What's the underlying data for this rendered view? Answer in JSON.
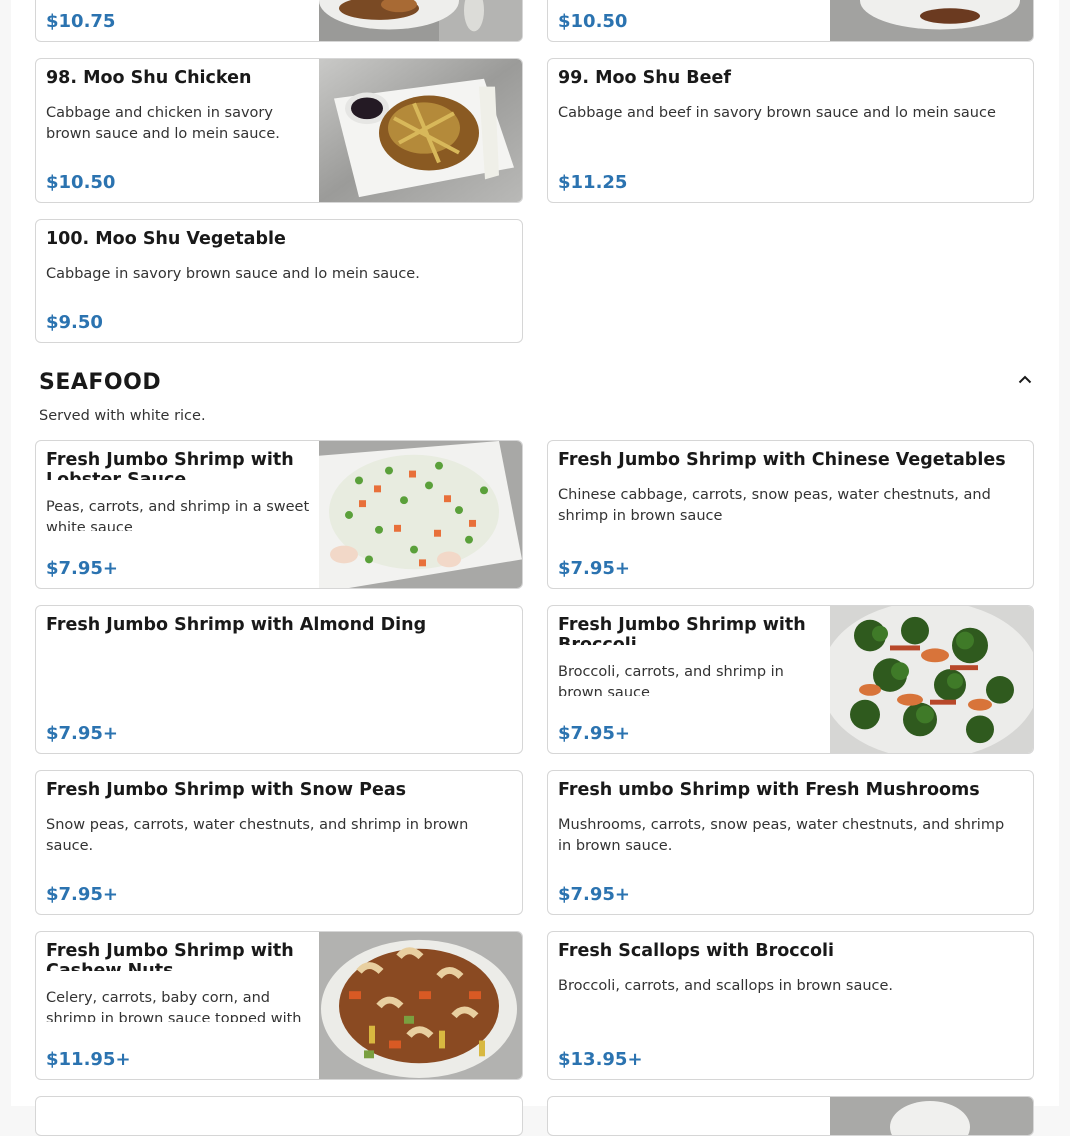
{
  "colors": {
    "price": "#2b73b0",
    "border": "#d6d6d6"
  },
  "top_cards": [
    {
      "price": "$10.75"
    },
    {
      "price": "$10.50"
    }
  ],
  "items": [
    {
      "title": "98. Moo Shu Chicken",
      "description": "Cabbage and chicken in savory brown sauce and lo mein sauce.",
      "price": "$10.50",
      "image": "moo-shu-chicken-photo"
    },
    {
      "title": "99. Moo Shu Beef",
      "description": "Cabbage and beef in savory brown sauce and lo mein sauce",
      "price": "$11.25"
    },
    {
      "title": "100. Moo Shu Vegetable",
      "description": "Cabbage in savory brown sauce and lo mein sauce.",
      "price": "$9.50"
    }
  ],
  "seafood": {
    "title": "SEAFOOD",
    "subtitle": "Served with white rice.",
    "collapse_icon": "chevron-up-icon",
    "items": [
      {
        "title": "Fresh Jumbo Shrimp with Lobster Sauce",
        "description": "Peas, carrots, and shrimp in a sweet white sauce",
        "price": "$7.95+",
        "image": "shrimp-lobster-sauce-photo"
      },
      {
        "title": "Fresh Jumbo Shrimp with Chinese Vegetables",
        "description": "Chinese cabbage, carrots, snow peas, water chestnuts, and shrimp in brown sauce",
        "price": "$7.95+"
      },
      {
        "title": "Fresh Jumbo Shrimp with Almond Ding",
        "description": "",
        "price": "$7.95+"
      },
      {
        "title": "Fresh Jumbo Shrimp with Broccoli",
        "description": "Broccoli, carrots, and shrimp in brown sauce",
        "price": "$7.95+",
        "image": "shrimp-broccoli-photo"
      },
      {
        "title": "Fresh Jumbo Shrimp with Snow Peas",
        "description": "Snow peas, carrots, water chestnuts, and shrimp in brown sauce.",
        "price": "$7.95+"
      },
      {
        "title": "Fresh umbo Shrimp with Fresh Mushrooms",
        "description": "Mushrooms, carrots, snow peas, water chestnuts, and shrimp in brown sauce.",
        "price": "$7.95+"
      },
      {
        "title": "Fresh Jumbo Shrimp with Cashew Nuts",
        "description": "Celery, carrots, baby corn, and shrimp in brown sauce topped with",
        "price": "$11.95+",
        "image": "shrimp-cashew-photo"
      },
      {
        "title": "Fresh Scallops with Broccoli",
        "description": "Broccoli, carrots, and scallops in brown sauce.",
        "price": "$13.95+"
      }
    ]
  }
}
